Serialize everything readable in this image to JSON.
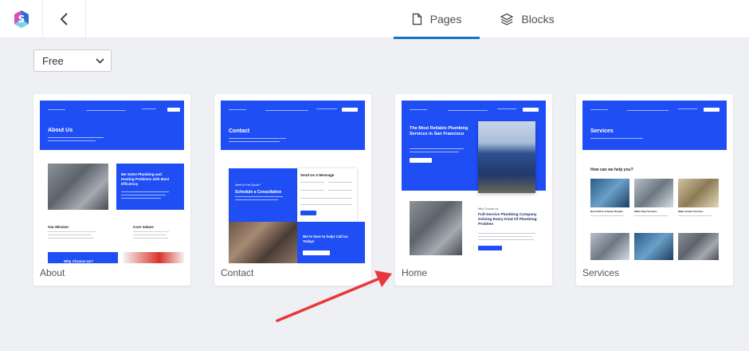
{
  "header": {
    "logo_icon": "app-logo-icon",
    "back_icon": "chevron-left-icon",
    "tabs": [
      {
        "label": "Pages",
        "icon": "page-icon",
        "active": true
      },
      {
        "label": "Blocks",
        "icon": "layers-icon",
        "active": false
      }
    ],
    "accent_color": "#1a73c6"
  },
  "filter": {
    "selected": "Free",
    "options": [
      "Free"
    ]
  },
  "cards": [
    {
      "label": "About",
      "thumb": {
        "hero": "About Us",
        "feature": "We Solve Plumbing and Heating Problems with Most Efficiency",
        "col1": "Our Mission",
        "col2": "Core Values",
        "banner": "Why Choose Us?"
      }
    },
    {
      "label": "Contact",
      "thumb": {
        "hero": "Contact",
        "form_title": "Send Us A Message",
        "left_small": "Need A Free Quote?",
        "left_title": "Schedule a Consultation",
        "cta": "We're here to help! Call Us Today!"
      }
    },
    {
      "label": "Home",
      "thumb": {
        "hero": "The Most Reliable Plumbing Services in San Francisco",
        "sub_small": "Why Choose Us",
        "sub_title": "Full-Service Plumbing Company Solving Every Kind Of Plumbing Problem"
      }
    },
    {
      "label": "Services",
      "thumb": {
        "hero": "Services",
        "question": "How can we help you?",
        "items": [
          "Best Drains & Sewer Repairs",
          "Water Pipe Services",
          "Water Heater Services"
        ]
      }
    }
  ],
  "theme": {
    "brand_blue": "#1f4ef5",
    "annotation_arrow": "#e8383b"
  }
}
